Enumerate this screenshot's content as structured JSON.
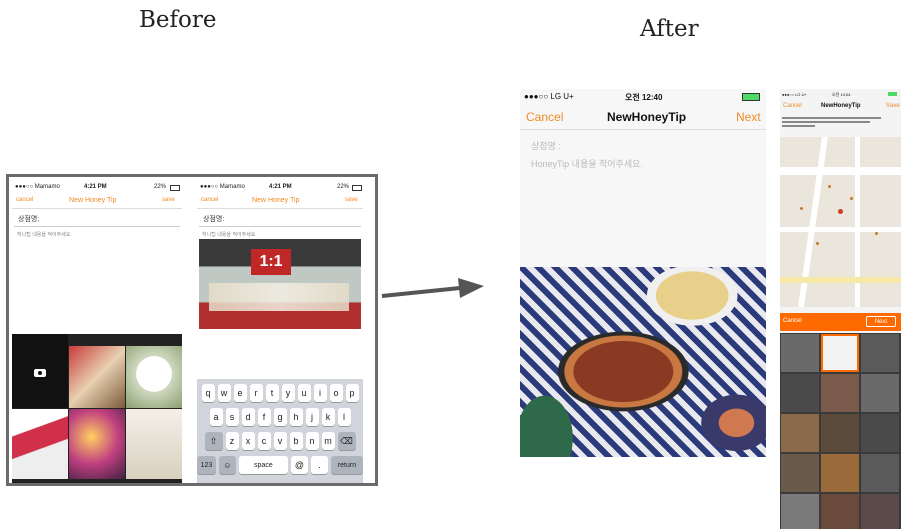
{
  "labels": {
    "before": "Before",
    "after": "After"
  },
  "before": {
    "phone1": {
      "carrier": "●●●○○ Mamamo",
      "time": "4:21 PM",
      "battery": "22%",
      "cancel": "cancel",
      "title": "New Honey Tip",
      "save": "save",
      "store_label": "상점명:",
      "content_hint": "허니팁 내용을 적어주세요."
    },
    "phone2": {
      "carrier": "●●●○○ Mamamo",
      "time": "4:21 PM",
      "battery": "22%",
      "cancel": "cancel",
      "title": "New Honey Tip",
      "save": "save",
      "store_label": "상점명:",
      "content_hint": "허니팁 내용을 적어주세요.",
      "photo_sign": "1:1",
      "keyboard": {
        "row1": [
          "q",
          "w",
          "e",
          "r",
          "t",
          "y",
          "u",
          "i",
          "o",
          "p"
        ],
        "row2": [
          "a",
          "s",
          "d",
          "f",
          "g",
          "h",
          "j",
          "k",
          "l"
        ],
        "row3": [
          "z",
          "x",
          "c",
          "v",
          "b",
          "n",
          "m"
        ],
        "numbers": "123",
        "space": "space",
        "at": "@",
        "dot": ".",
        "return": "return"
      }
    }
  },
  "after": {
    "main": {
      "carrier": "●●●○○ LG U+",
      "time": "오전 12:40",
      "cancel": "Cancel",
      "title": "NewHoneyTip",
      "next": "Next",
      "store_placeholder": "상점명 :",
      "content_placeholder": "HoneyTip 내용을 적어주세요."
    },
    "side": {
      "carrier": "●●●○○ LG U+",
      "time": "오전 10:04",
      "cancel": "Cancel",
      "title": "NewHoneyTip",
      "save": "Save",
      "picker_cancel": "Cancel",
      "picker_next": "Next"
    }
  },
  "colors": {
    "accent": "#f08a24",
    "orange_bar": "#ff6a00",
    "map_pin": "#d04020"
  }
}
